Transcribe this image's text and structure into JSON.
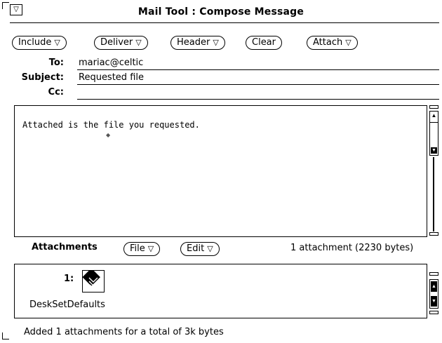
{
  "window": {
    "title": "Mail Tool : Compose Message",
    "menu_glyph": "▽"
  },
  "toolbar": {
    "buttons": [
      {
        "label": "Include",
        "arrow": "▽"
      },
      {
        "label": "Deliver",
        "arrow": "▽"
      },
      {
        "label": "Header",
        "arrow": "▽"
      },
      {
        "label": "Clear",
        "arrow": ""
      },
      {
        "label": "Attach",
        "arrow": "▽"
      }
    ]
  },
  "header_fields": {
    "to_label": "To:",
    "to_value": "mariac@celtic",
    "subject_label": "Subject:",
    "subject_value": "Requested file",
    "cc_label": "Cc:",
    "cc_value": ""
  },
  "message": {
    "body": "Attached is the file you requested."
  },
  "attachments_bar": {
    "label": "Attachments",
    "file_button": "File",
    "edit_button": "Edit",
    "arrow": "▽",
    "summary": "1 attachment (2230 bytes)"
  },
  "attachment_list": [
    {
      "index": "1:",
      "name": "DeskSetDefaults",
      "icon": "desk-set-file-icon"
    }
  ],
  "status": {
    "text": "Added 1 attachments for a total of 3k bytes"
  },
  "scrollbar": {
    "up_glyph": "▲",
    "down_glyph": "▼"
  }
}
